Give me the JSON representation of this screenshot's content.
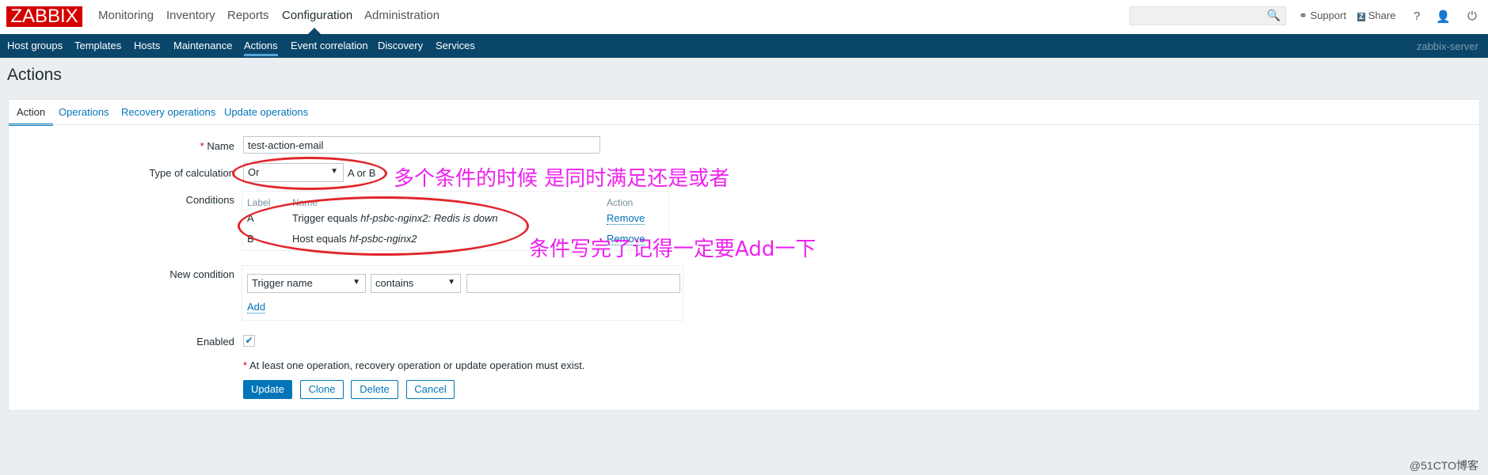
{
  "header": {
    "logo": "ZABBIX",
    "nav": [
      "Monitoring",
      "Inventory",
      "Reports",
      "Configuration",
      "Administration"
    ],
    "active_nav": "Configuration",
    "search_placeholder": "",
    "support": "Support",
    "share": "Share",
    "help": "?"
  },
  "subnav": {
    "items": [
      "Host groups",
      "Templates",
      "Hosts",
      "Maintenance",
      "Actions",
      "Event correlation",
      "Discovery",
      "Services"
    ],
    "active": "Actions",
    "server": "zabbix-server"
  },
  "page_title": "Actions",
  "tabs": [
    "Action",
    "Operations",
    "Recovery operations",
    "Update operations"
  ],
  "form": {
    "name_label": "Name",
    "name_value": "test-action-email",
    "calc_label": "Type of calculation",
    "calc_value": "Or",
    "calc_formula": "A or B",
    "conditions_label": "Conditions",
    "conditions_headers": [
      "Label",
      "Name",
      "Action"
    ],
    "conditions": [
      {
        "label": "A",
        "name_prefix": "Trigger equals ",
        "name_value": "hf-psbc-nginx2: Redis is down",
        "action": "Remove"
      },
      {
        "label": "B",
        "name_prefix": "Host equals ",
        "name_value": "hf-psbc-nginx2",
        "action": "Remove"
      }
    ],
    "new_condition_label": "New condition",
    "new_condition_type": "Trigger name",
    "new_condition_operator": "contains",
    "new_condition_value": "",
    "add_label": "Add",
    "enabled_label": "Enabled",
    "enabled": true,
    "note": "At least one operation, recovery operation or update operation must exist.",
    "buttons": {
      "update": "Update",
      "clone": "Clone",
      "delete": "Delete",
      "cancel": "Cancel"
    }
  },
  "annotations": [
    "多个条件的时候 是同时满足还是或者",
    "条件写完了记得一定要Add一下"
  ],
  "watermark": "@51CTO博客",
  "colors": {
    "brand": "#d40000",
    "nav": "#0a466a",
    "link": "#0275b8",
    "annotation": "#ee22ee",
    "ellipse": "#e0262c"
  }
}
